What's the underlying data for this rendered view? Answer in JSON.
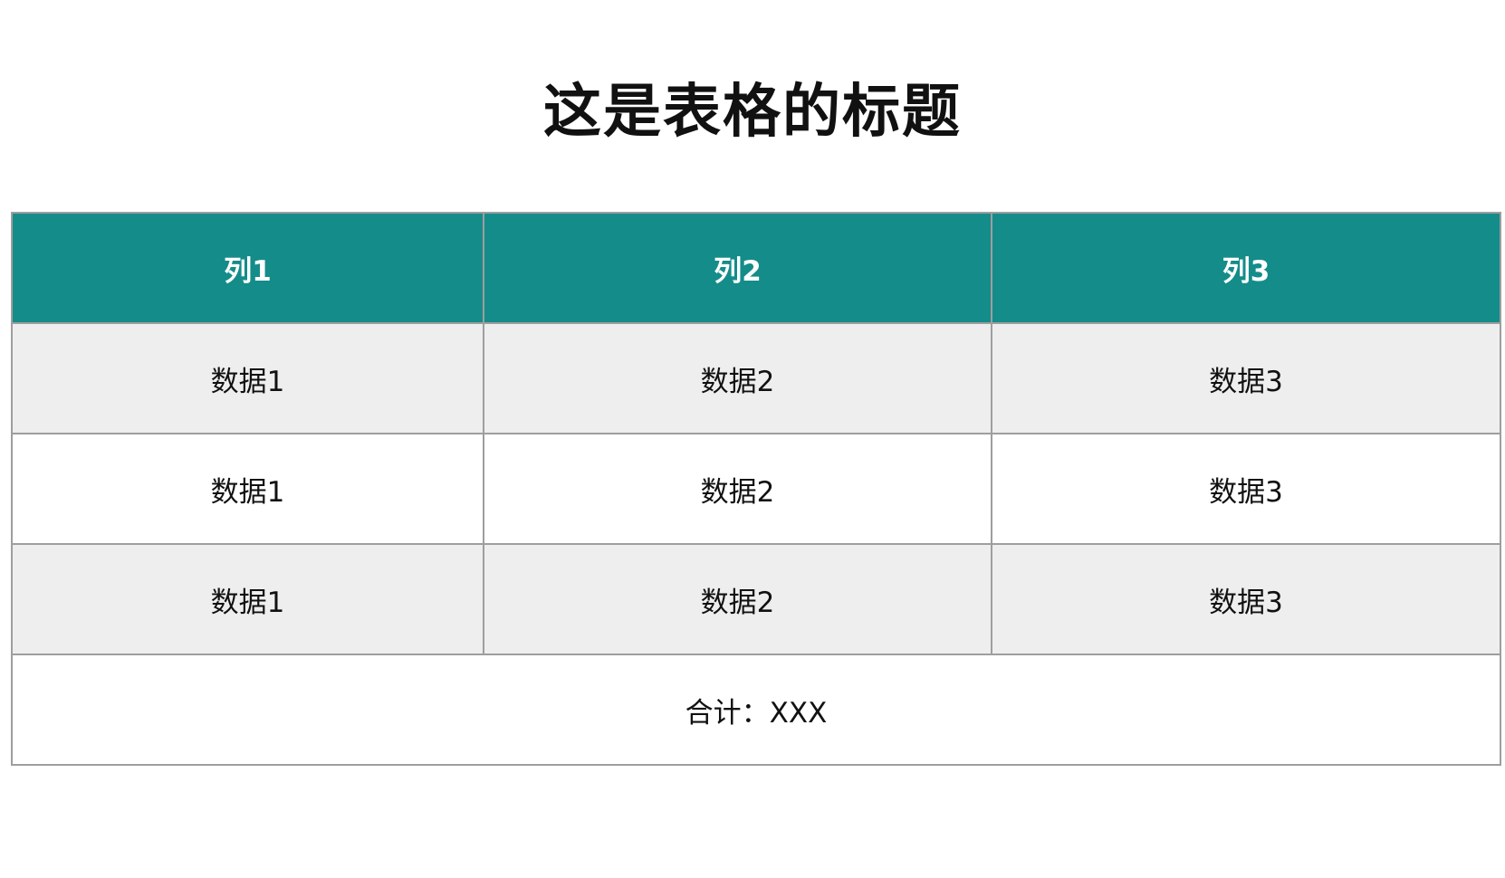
{
  "title": "这是表格的标题",
  "colors": {
    "header_bg": "#148c8a",
    "header_text": "#ffffff",
    "stripe_bg": "#eeeeee",
    "row_bg": "#ffffff",
    "border": "#9e9e9e"
  },
  "table": {
    "headers": [
      "列1",
      "列2",
      "列3"
    ],
    "rows": [
      [
        "数据1",
        "数据2",
        "数据3"
      ],
      [
        "数据1",
        "数据2",
        "数据3"
      ],
      [
        "数据1",
        "数据2",
        "数据3"
      ]
    ],
    "total": "合计：XXX"
  }
}
